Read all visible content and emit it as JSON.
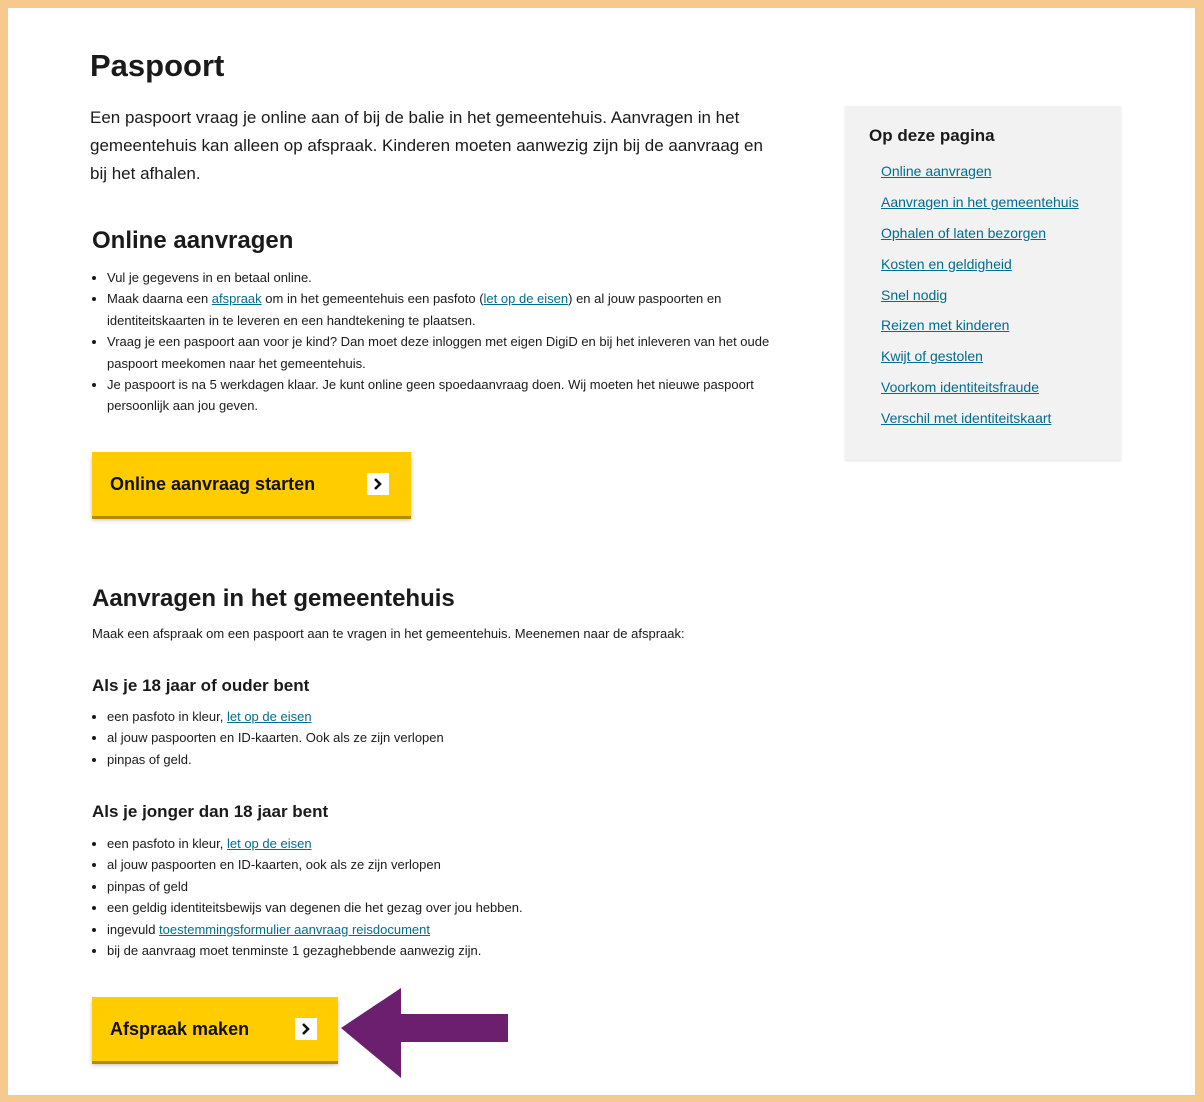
{
  "page": {
    "title": "Paspoort",
    "intro": "Een paspoort vraag je online aan of bij de balie in het gemeentehuis. Aanvragen in het gemeentehuis kan alleen op afspraak. Kinderen moeten aanwezig zijn bij de aanvraag en bij het afhalen."
  },
  "online": {
    "heading": "Online aanvragen",
    "b1": "Vul je gegevens in en betaal online.",
    "b2_a": "Maak daarna een ",
    "b2_link1": "afspraak",
    "b2_b": " om in het gemeentehuis een pasfoto (",
    "b2_link2": "let op de eisen",
    "b2_c": ") en al jouw paspoorten en identiteitskaarten in te leveren en een handtekening te plaatsen.",
    "b3": "Vraag je een paspoort aan voor je kind? Dan moet deze inloggen met eigen DigiD en bij het inleveren van het oude paspoort meekomen naar het gemeentehuis.",
    "b4": "Je paspoort is na 5 werkdagen klaar. Je kunt online geen spoedaanvraag doen. Wij moeten het nieuwe paspoort persoonlijk aan jou geven.",
    "button": "Online aanvraag starten"
  },
  "gemeentehuis": {
    "heading": "Aanvragen in het gemeentehuis",
    "intro": "Maak een afspraak om een paspoort aan te vragen in het gemeentehuis. Meenemen naar de afspraak:",
    "adult_heading": "Als je 18 jaar of ouder bent",
    "adult_b1_a": "een pasfoto in kleur, ",
    "adult_b1_link": "let op de eisen",
    "adult_b2": "al jouw paspoorten en ID-kaarten. Ook als ze zijn verlopen",
    "adult_b3": "pinpas of geld.",
    "minor_heading": "Als je jonger dan 18 jaar bent",
    "minor_b1_a": "een pasfoto in kleur, ",
    "minor_b1_link": "let op de eisen",
    "minor_b2": "al jouw paspoorten en ID-kaarten, ook als ze zijn verlopen",
    "minor_b3": "pinpas of geld",
    "minor_b4": "een geldig identiteitsbewijs van degenen die het gezag over jou hebben.",
    "minor_b5_a": "ingevuld ",
    "minor_b5_link": "toestemmingsformulier aanvraag reisdocument",
    "minor_b6": "bij de aanvraag moet tenminste 1 gezaghebbende aanwezig zijn.",
    "button": "Afspraak maken"
  },
  "toc": {
    "title": "Op deze pagina",
    "items": [
      "Online aanvragen",
      "Aanvragen in het gemeentehuis",
      "Ophalen of laten bezorgen",
      "Kosten en geldigheid",
      "Snel nodig",
      "Reizen met kinderen",
      "Kwijt of gestolen",
      "Voorkom identiteitsfraude",
      "Verschil met identiteitskaart"
    ]
  },
  "colors": {
    "frame": "#f6c98f",
    "button": "#ffcc00",
    "link": "#006d8f",
    "arrow": "#6b1f6e",
    "toc_bg": "#f2f2f2"
  },
  "icons": [
    "chevron-right-icon",
    "arrow-left-icon"
  ]
}
